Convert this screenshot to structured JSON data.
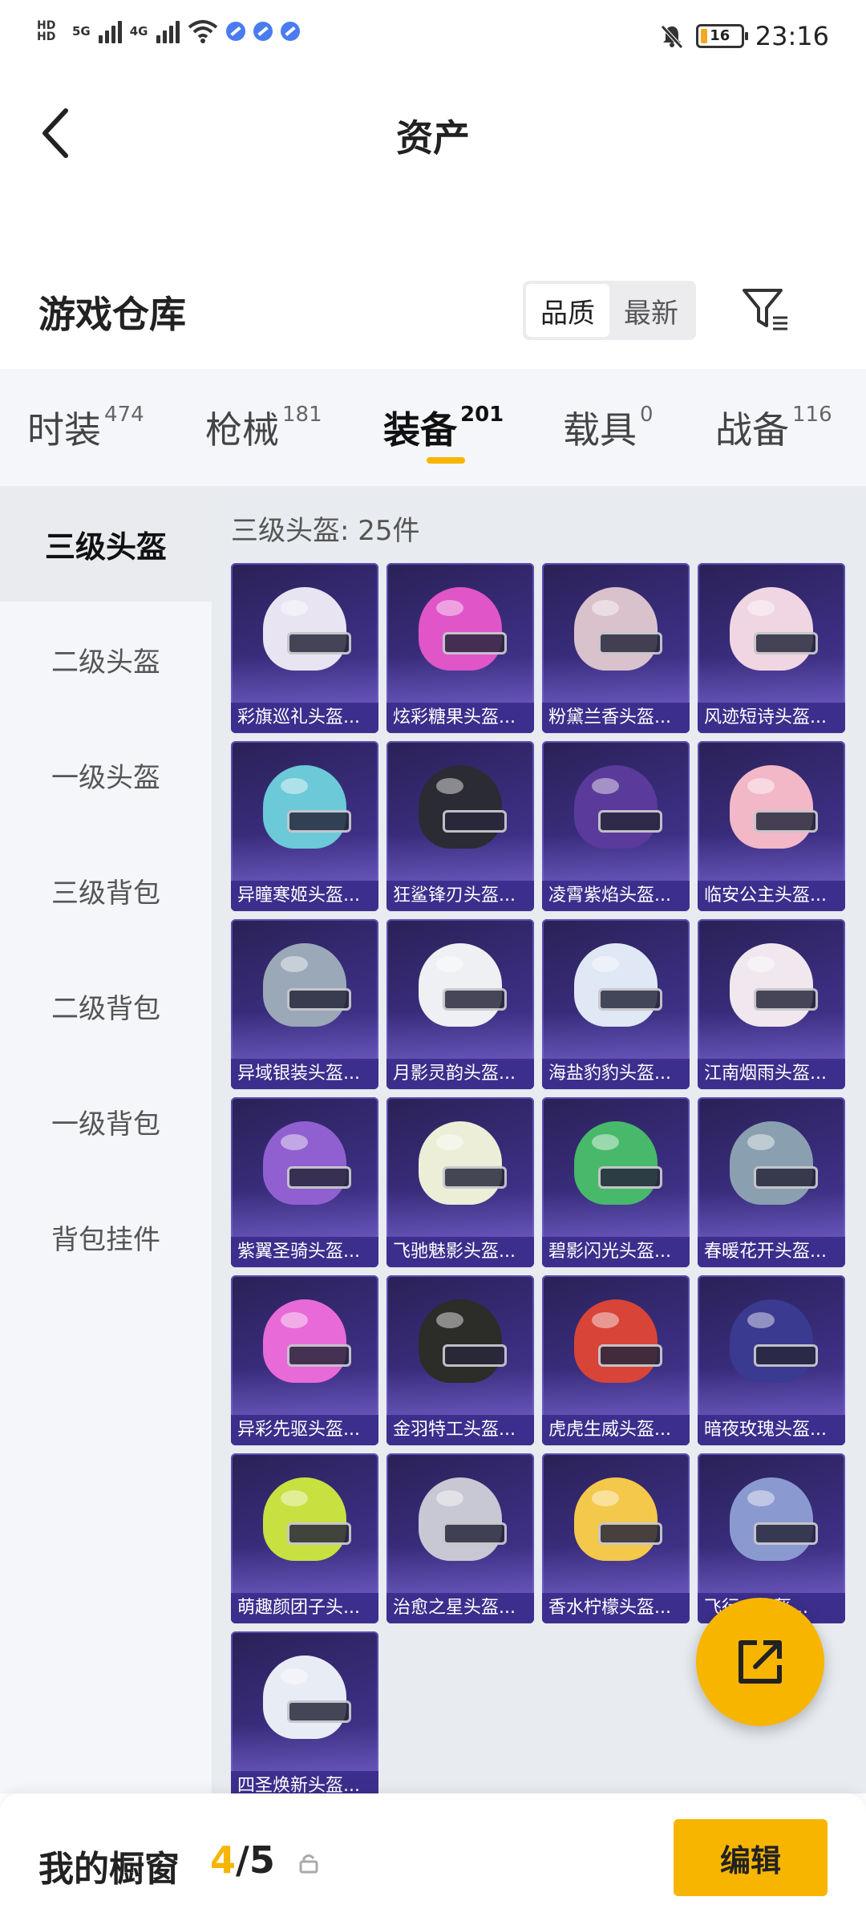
{
  "status_bar": {
    "network": "5G",
    "network2": "4G",
    "hd1": "HD",
    "hd2": "HD",
    "battery": "16",
    "time": "23:16"
  },
  "nav": {
    "title": "资产"
  },
  "section": {
    "title": "游戏仓库"
  },
  "sort": {
    "options": [
      "品质",
      "最新"
    ],
    "selected": "品质"
  },
  "tabs": [
    {
      "label": "时装",
      "count": "474"
    },
    {
      "label": "枪械",
      "count": "181"
    },
    {
      "label": "装备",
      "count": "201"
    },
    {
      "label": "载具",
      "count": "0"
    },
    {
      "label": "战备",
      "count": "116"
    }
  ],
  "active_tab": "装备",
  "sidebar": {
    "items": [
      "三级头盔",
      "二级头盔",
      "一级头盔",
      "三级背包",
      "二级背包",
      "一级背包",
      "背包挂件"
    ],
    "active": "三级头盔"
  },
  "content": {
    "count_label": "三级头盔: 25件",
    "items": [
      {
        "name": "彩旗巡礼头盔...",
        "color": "#e8e4f2"
      },
      {
        "name": "炫彩糖果头盔...",
        "color": "#e055c8"
      },
      {
        "name": "粉黛兰香头盔...",
        "color": "#d9c2cc"
      },
      {
        "name": "风迹短诗头盔...",
        "color": "#f0d5e2"
      },
      {
        "name": "异瞳寒姬头盔...",
        "color": "#6cc9d8"
      },
      {
        "name": "狂鲨锋刃头盔...",
        "color": "#2b2b33"
      },
      {
        "name": "凌霄紫焰头盔...",
        "color": "#5a3a9a"
      },
      {
        "name": "临安公主头盔...",
        "color": "#f2b8c8"
      },
      {
        "name": "异域银装头盔...",
        "color": "#9aa8b8"
      },
      {
        "name": "月影灵韵头盔...",
        "color": "#eef0f4"
      },
      {
        "name": "海盐豹豹头盔...",
        "color": "#dfe8f4"
      },
      {
        "name": "江南烟雨头盔...",
        "color": "#f0e8ee"
      },
      {
        "name": "紫翼圣骑头盔...",
        "color": "#9060d0"
      },
      {
        "name": "飞驰魅影头盔...",
        "color": "#eceed8"
      },
      {
        "name": "碧影闪光头盔...",
        "color": "#48b86a"
      },
      {
        "name": "春暖花开头盔...",
        "color": "#8aa0b0"
      },
      {
        "name": "异彩先驱头盔...",
        "color": "#e86ad8"
      },
      {
        "name": "金羽特工头盔...",
        "color": "#2c2c28"
      },
      {
        "name": "虎虎生威头盔...",
        "color": "#d84438"
      },
      {
        "name": "暗夜玫瑰头盔...",
        "color": "#3a3a90"
      },
      {
        "name": "萌趣颜团子头...",
        "color": "#c8e040"
      },
      {
        "name": "治愈之星头盔...",
        "color": "#c8c8d4"
      },
      {
        "name": "香水柠檬头盔...",
        "color": "#f4c84a"
      },
      {
        "name": "飞行...头盔...",
        "color": "#8a9ad0"
      },
      {
        "name": "四圣焕新头盔...",
        "color": "#e8ecf4"
      }
    ]
  },
  "bottom_bar": {
    "label": "我的橱窗",
    "current": "4",
    "separator": "/",
    "total": "5",
    "edit_label": "编辑"
  },
  "colors": {
    "accent": "#f7b500",
    "card_bg": "#3a2d7e"
  }
}
